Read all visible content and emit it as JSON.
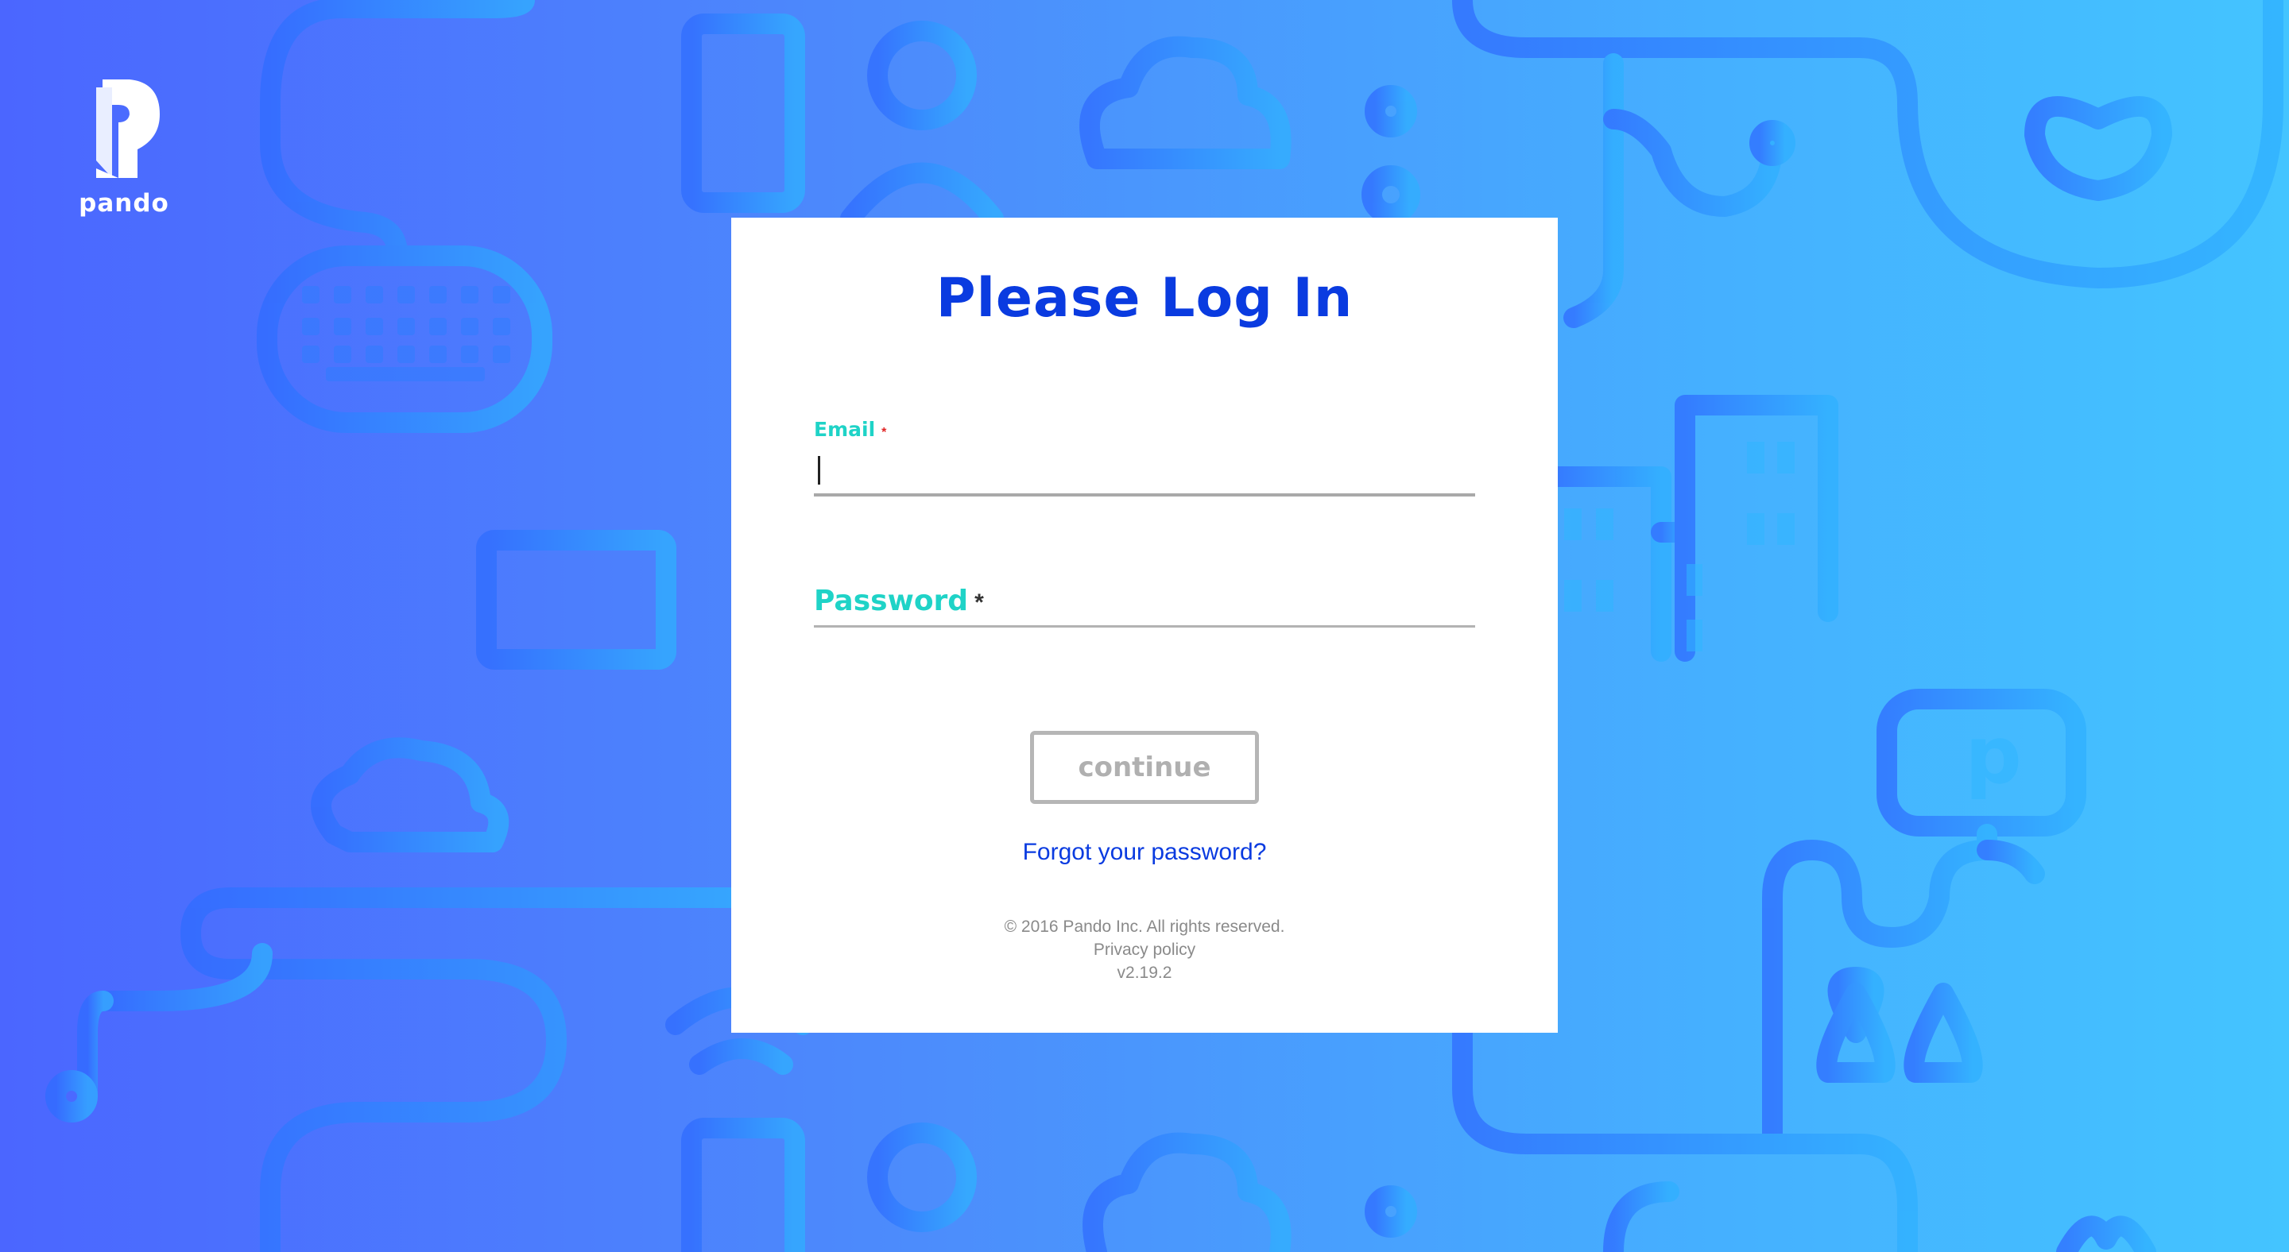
{
  "brand": {
    "name": "pando",
    "logo_icon": "pando-logo-icon"
  },
  "login": {
    "title": "Please Log In",
    "email": {
      "label": "Email",
      "required_marker": "*",
      "value": "",
      "placeholder": ""
    },
    "password": {
      "label": "Password",
      "required_marker": "*",
      "value": "",
      "placeholder": ""
    },
    "continue_label": "continue",
    "forgot_label": "Forgot your password?"
  },
  "footer": {
    "copyright": "© 2016 Pando Inc. All rights reserved.",
    "privacy": "Privacy policy",
    "version": "v2.19.2"
  },
  "colors": {
    "title_blue": "#0a3be0",
    "label_teal": "#1fd3c7",
    "required_red": "#e02424",
    "button_gray": "#b6b6b6",
    "bg_left": "#4b66ff",
    "bg_right": "#44c4ff"
  },
  "background_icons": [
    "keyboard-icon",
    "phone-icon",
    "person-icon",
    "cloud-icon",
    "monitor-icon",
    "buildings-icon",
    "tablet-icon",
    "trees-icon",
    "wifi-icon",
    "heart-icon"
  ]
}
